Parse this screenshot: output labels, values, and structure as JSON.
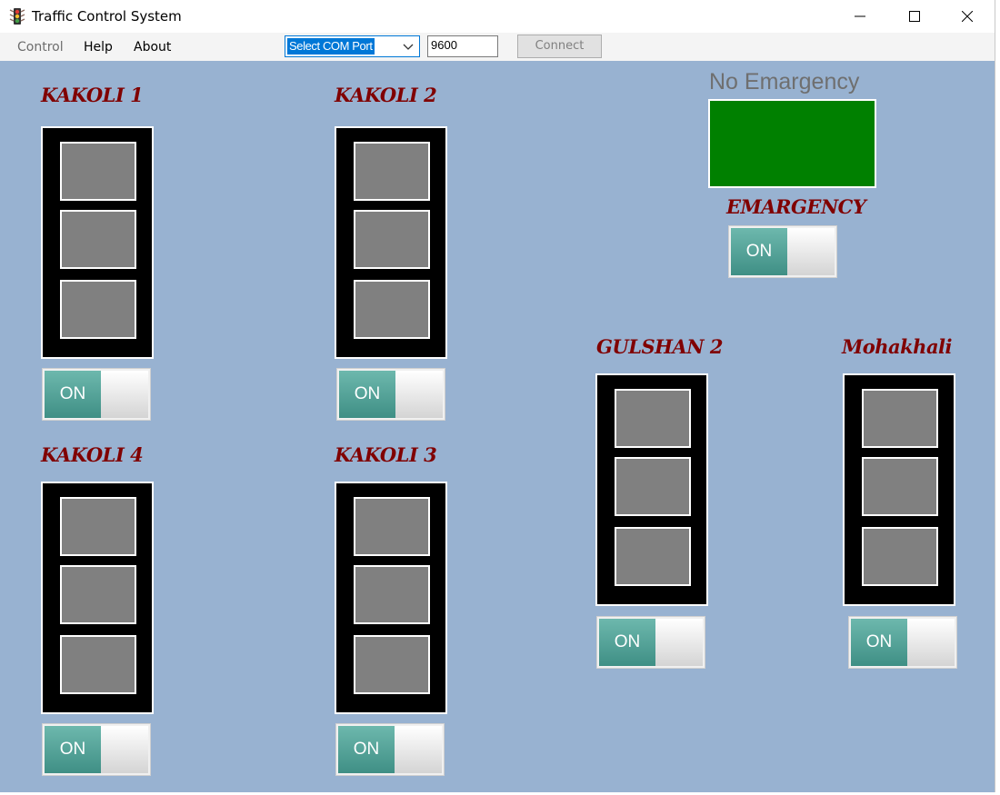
{
  "window": {
    "title": "Traffic Control System",
    "icon": "traffic-light-icon"
  },
  "menu": {
    "control": "Control",
    "help": "Help",
    "about": "About"
  },
  "com_port": {
    "selected": "Select COM Port"
  },
  "baud": {
    "value": "9600"
  },
  "connect": {
    "label": "Connect"
  },
  "emergency": {
    "status": "No Emargency",
    "status_color": "#008000",
    "label": "EMARGENCY",
    "toggle": "ON"
  },
  "stations": {
    "kakoli1": {
      "name": "KAKOLI 1",
      "toggle": "ON"
    },
    "kakoli2": {
      "name": "KAKOLI 2",
      "toggle": "ON"
    },
    "kakoli4": {
      "name": "KAKOLI 4",
      "toggle": "ON"
    },
    "kakoli3": {
      "name": "KAKOLI 3",
      "toggle": "ON"
    },
    "gulshan2": {
      "name": "GULSHAN 2",
      "toggle": "ON"
    },
    "mohakhali": {
      "name": "Mohakhali",
      "toggle": "ON"
    }
  },
  "colors": {
    "background": "#98b2d1",
    "label": "#800000",
    "lamp_off": "#808080",
    "toggle_on": "#4d9e93"
  }
}
